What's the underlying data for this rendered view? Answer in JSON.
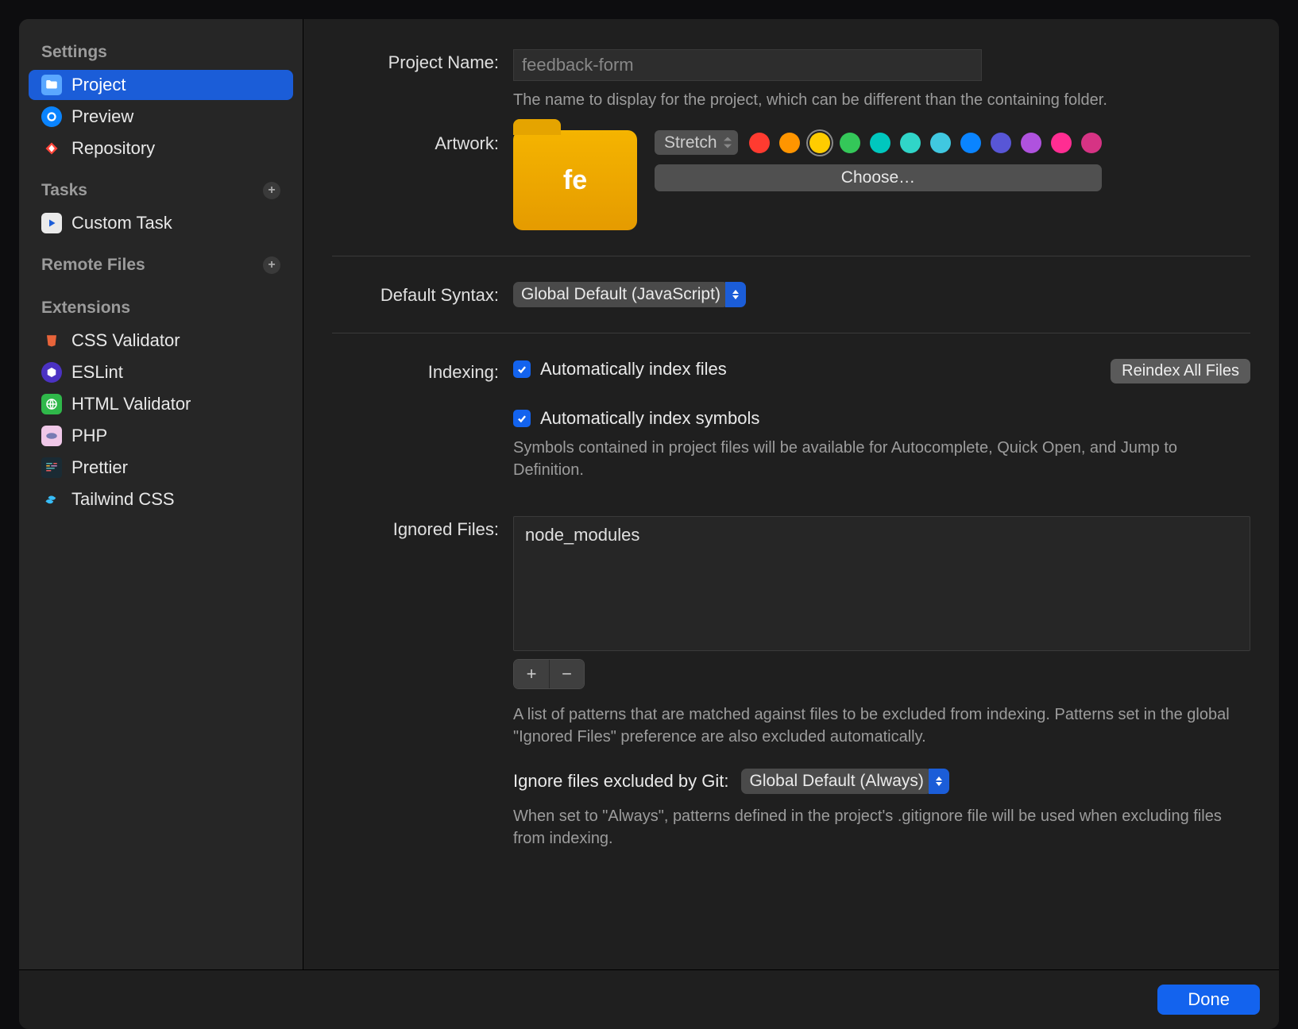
{
  "sidebar": {
    "settings_header": "Settings",
    "tasks_header": "Tasks",
    "remote_header": "Remote Files",
    "extensions_header": "Extensions",
    "settings": {
      "project": "Project",
      "preview": "Preview",
      "repository": "Repository"
    },
    "tasks": {
      "custom": "Custom Task"
    },
    "extensions": {
      "css": "CSS Validator",
      "eslint": "ESLint",
      "html": "HTML Validator",
      "php": "PHP",
      "prettier": "Prettier",
      "tailwind": "Tailwind CSS"
    }
  },
  "form": {
    "project_name_label": "Project Name:",
    "project_name_value": "feedback-form",
    "project_name_help": "The name to display for the project, which can be different than the containing folder.",
    "artwork_label": "Artwork:",
    "artwork_abbrev": "fe",
    "artwork_stretch": "Stretch",
    "artwork_choose": "Choose…",
    "default_syntax_label": "Default Syntax:",
    "default_syntax_value": "Global Default (JavaScript)",
    "indexing_label": "Indexing:",
    "index_files_label": "Automatically index files",
    "reindex_label": "Reindex All Files",
    "index_symbols_label": "Automatically index symbols",
    "index_symbols_help": "Symbols contained in project files will be available for Autocomplete, Quick Open, and Jump to Definition.",
    "ignored_label": "Ignored Files:",
    "ignored_items": [
      "node_modules"
    ],
    "ignored_help": "A list of patterns that are matched against files to be excluded from indexing. Patterns set in the global \"Ignored Files\" preference are also excluded automatically.",
    "git_label": "Ignore files excluded by Git:",
    "git_value": "Global Default (Always)",
    "git_help": "When set to \"Always\", patterns defined in the project's .gitignore file will be used when excluding files from indexing."
  },
  "swatches": [
    "#ff3b30",
    "#ff9500",
    "#ffcc00",
    "#34c759",
    "#00c7be",
    "#30d5c8",
    "#40c8e0",
    "#0a84ff",
    "#5856d6",
    "#af52de",
    "#ff2d92",
    "#d63384"
  ],
  "swatch_selected_index": 2,
  "footer": {
    "done": "Done"
  }
}
